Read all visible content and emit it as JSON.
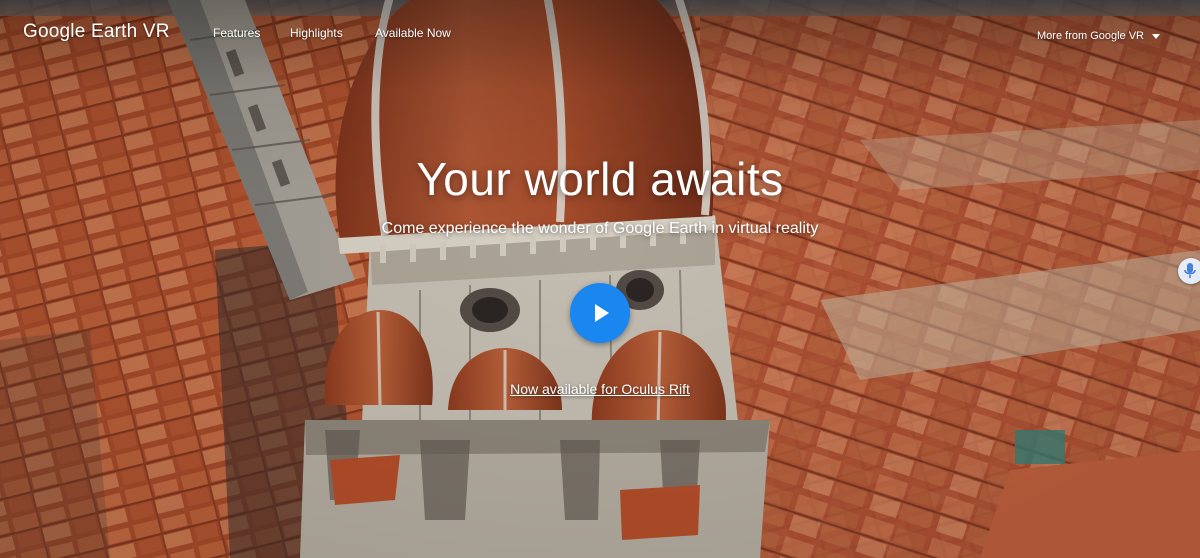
{
  "brand": {
    "text": "Google Earth VR"
  },
  "nav": {
    "items": [
      {
        "label": "Features"
      },
      {
        "label": "Highlights"
      },
      {
        "label": "Available Now"
      }
    ],
    "more_label": "More from Google VR",
    "more_icon": "chevron-down-icon"
  },
  "hero": {
    "title": "Your world awaits",
    "subtitle": "Come experience the wonder of Google Earth in virtual reality",
    "play_icon": "play-icon",
    "cta_label": "Now available for Oculus Rift"
  },
  "colors": {
    "play_button": "#1a86f0",
    "text": "#ffffff",
    "roof_terracotta": "#c8562e",
    "dome_brick": "#b8552f",
    "marble": "#d9d2c5"
  }
}
